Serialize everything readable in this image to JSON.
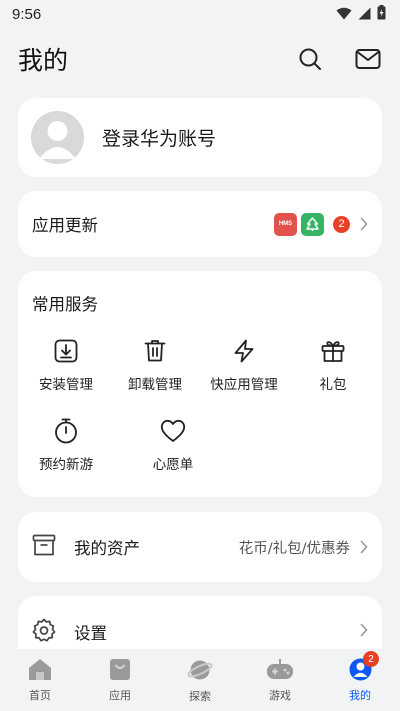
{
  "status_bar": {
    "time": "9:56"
  },
  "header": {
    "title": "我的",
    "icons": [
      "search-icon",
      "mail-icon"
    ]
  },
  "profile": {
    "login_text": "登录华为账号"
  },
  "app_update": {
    "label": "应用更新",
    "chips": [
      {
        "text": "HMS",
        "color": "#e0524b"
      },
      {
        "text": "",
        "color": "#34b464"
      }
    ],
    "count": "2"
  },
  "services": {
    "title": "常用服务",
    "items": [
      {
        "label": "安装管理",
        "icon": "install-icon"
      },
      {
        "label": "卸载管理",
        "icon": "trash-icon"
      },
      {
        "label": "快应用管理",
        "icon": "lightning-icon"
      },
      {
        "label": "礼包",
        "icon": "gift-icon"
      },
      {
        "label": "预约新游",
        "icon": "stopwatch-icon"
      },
      {
        "label": "心愿单",
        "icon": "heart-icon"
      }
    ]
  },
  "assets": {
    "label": "我的资产",
    "sub": "花币/礼包/优惠券"
  },
  "settings": {
    "label": "设置"
  },
  "bottom_nav": {
    "items": [
      {
        "label": "首页",
        "icon": "home-icon"
      },
      {
        "label": "应用",
        "icon": "bag-icon"
      },
      {
        "label": "探索",
        "icon": "planet-icon"
      },
      {
        "label": "游戏",
        "icon": "gamepad-icon"
      },
      {
        "label": "我的",
        "icon": "profile-icon",
        "active": true
      }
    ],
    "badge": "2"
  },
  "colors": {
    "accent": "#0a59f7",
    "badge": "#e84026",
    "background": "#f1f3f5"
  }
}
